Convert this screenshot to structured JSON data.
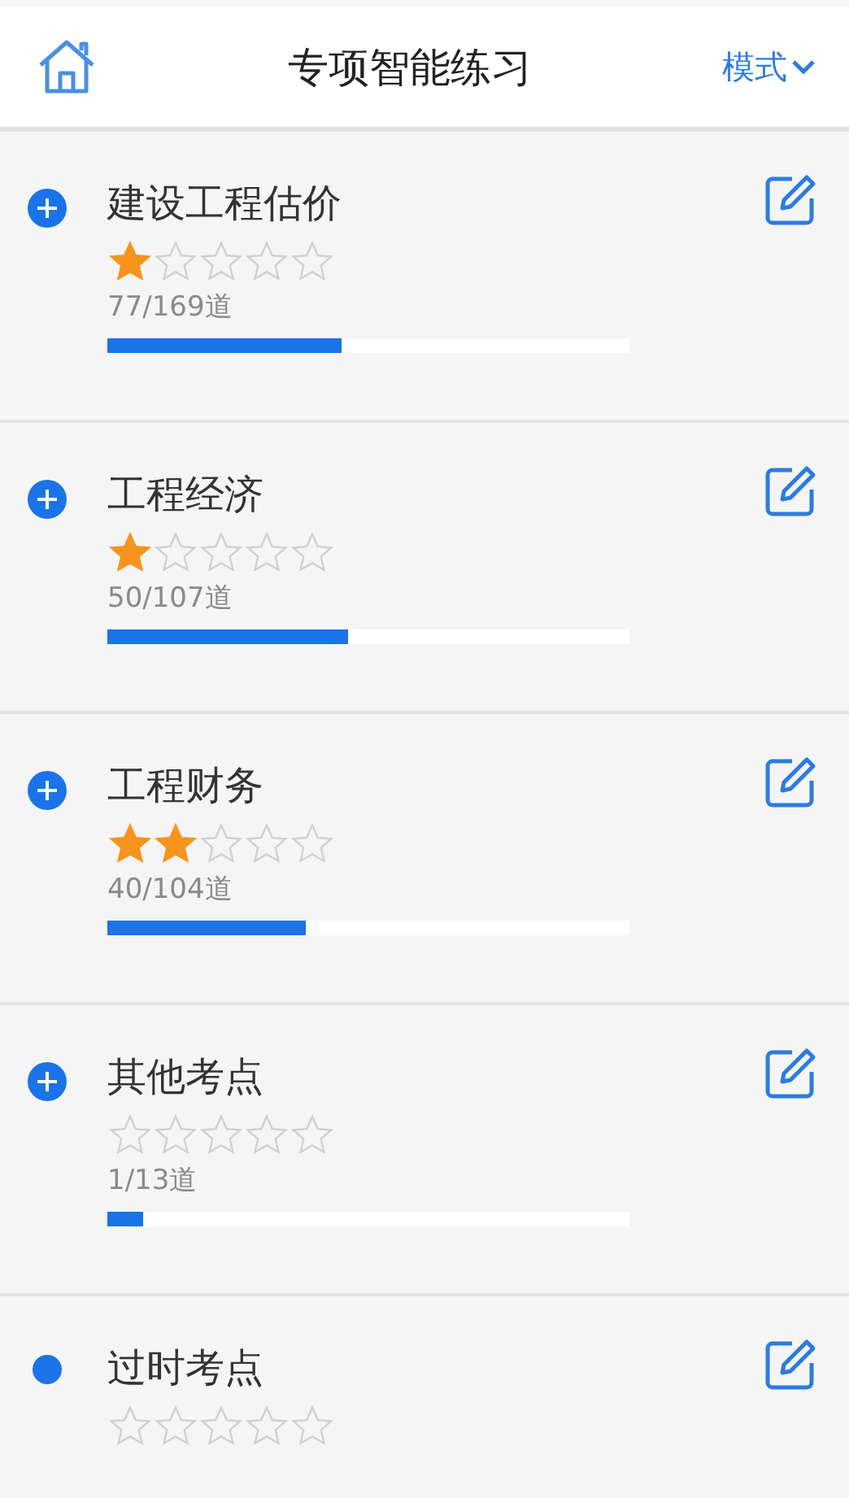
{
  "header": {
    "title": "专项智能练习",
    "mode_button": "模式"
  },
  "items": [
    {
      "kind": "group",
      "title": "建设工程估价",
      "stars": 1,
      "count": "77/169道",
      "level": 0.45
    },
    {
      "kind": "group",
      "title": "工程经济",
      "stars": 1,
      "count": "50/107道",
      "level": 0.46
    },
    {
      "kind": "group",
      "title": "工程财务",
      "stars": 2,
      "count": "40/104道",
      "level": 0.38
    },
    {
      "kind": "group",
      "title": "其他考点",
      "stars": 0,
      "count": "1/13道",
      "level": 0.07
    },
    {
      "kind": "leaf",
      "title": "过时考点",
      "stars": 0
    }
  ]
}
